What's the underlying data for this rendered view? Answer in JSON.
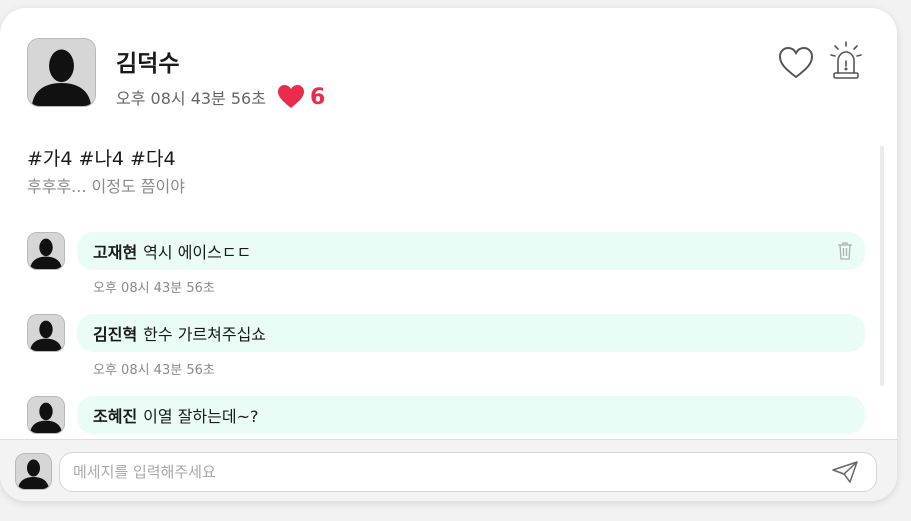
{
  "post": {
    "author": "김덕수",
    "time": "오후 08시 43분 56초",
    "like_count": "6",
    "tags": "#가4 #나4 #다4",
    "content": "후후후... 이정도 쯤이야"
  },
  "comments": [
    {
      "author": "고재현",
      "text": "역시 에이스ㄷㄷ",
      "time": "오후 08시 43분 56초",
      "deletable": true
    },
    {
      "author": "김진혁",
      "text": "한수 가르쳐주십쇼",
      "time": "오후 08시 43분 56초",
      "deletable": false
    },
    {
      "author": "조혜진",
      "text": "이열 잘하는데~?",
      "time": "",
      "deletable": false
    }
  ],
  "composer": {
    "placeholder": "메세지를 입력해주세요"
  },
  "colors": {
    "accent_heart": "#ec2a4b",
    "comment_bubble": "#e9fcf6"
  },
  "icons": {
    "like": "heart-outline-icon",
    "report": "siren-icon",
    "delete": "trash-icon",
    "send": "paper-plane-icon"
  }
}
